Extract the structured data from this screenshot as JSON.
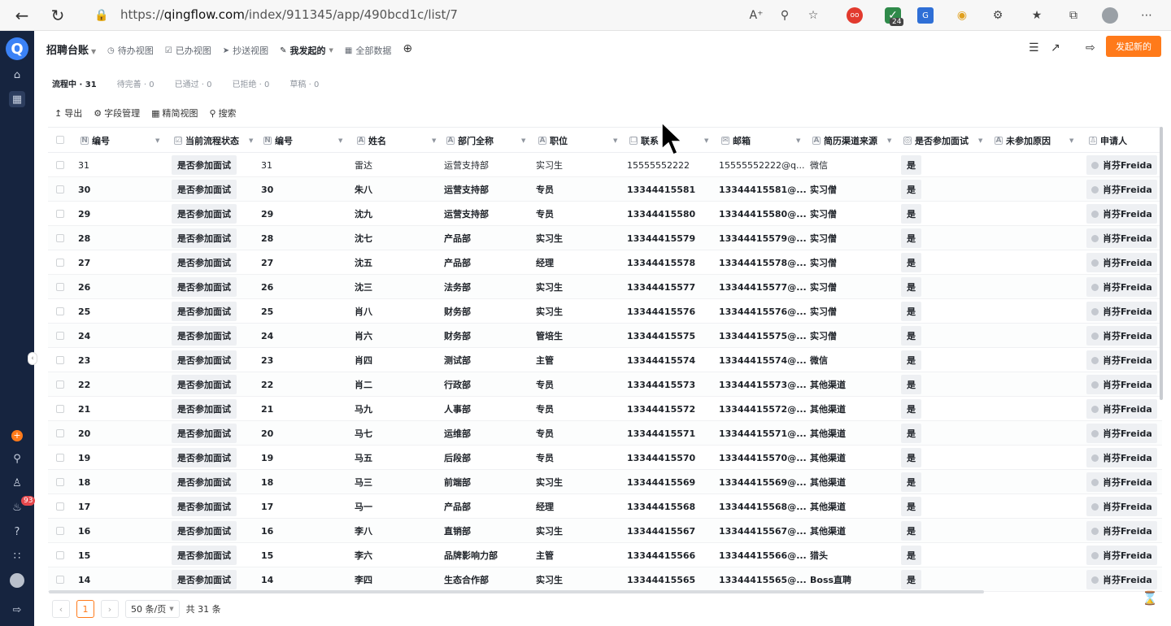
{
  "browser": {
    "url_prefix": "https://",
    "url_domain": "qingflow.com",
    "url_path": "/index/911345/app/490bcd1c/list/7",
    "ext_badge": "24"
  },
  "sidebar": {
    "logo": "Q",
    "notification_count": "93",
    "icons": [
      "home-icon",
      "apps-icon",
      "add-icon",
      "search-icon",
      "users-icon",
      "bell-icon",
      "help-icon",
      "grid-icon",
      "avatar",
      "expand-icon"
    ]
  },
  "header": {
    "app_title": "招聘台账",
    "views": [
      {
        "label": "待办视图",
        "icon": "clock-icon"
      },
      {
        "label": "已办视图",
        "icon": "check-square-icon"
      },
      {
        "label": "抄送视图",
        "icon": "send-icon"
      },
      {
        "label": "我发起的",
        "icon": "edit-square-icon"
      },
      {
        "label": "全部数据",
        "icon": "table-icon"
      }
    ],
    "launch_button": "发起新的"
  },
  "status_tabs": [
    "流程中 · 31",
    "待完善 · 0",
    "已通过 · 0",
    "已拒绝 · 0",
    "草稿 · 0"
  ],
  "toolbar": {
    "export": "导出",
    "fields": "字段管理",
    "compact": "精简视图",
    "search": "搜索"
  },
  "table": {
    "columns": [
      "编号",
      "当前流程状态",
      "编号",
      "姓名",
      "部门全称",
      "职位",
      "联系",
      "邮箱",
      "简历渠道来源",
      "是否参加面试",
      "未参加原因",
      "申请人"
    ],
    "rows": [
      [
        "31",
        "是否参加面试",
        "31",
        "雷达",
        "运营支持部",
        "实习生",
        "15555552222",
        "15555552222@q...",
        "微信",
        "是",
        "",
        "肖芬Freida"
      ],
      [
        "30",
        "是否参加面试",
        "30",
        "朱八",
        "运营支持部",
        "专员",
        "13344415581",
        "13344415581@...",
        "实习僧",
        "是",
        "",
        "肖芬Freida"
      ],
      [
        "29",
        "是否参加面试",
        "29",
        "沈九",
        "运营支持部",
        "专员",
        "13344415580",
        "13344415580@...",
        "实习僧",
        "是",
        "",
        "肖芬Freida"
      ],
      [
        "28",
        "是否参加面试",
        "28",
        "沈七",
        "产品部",
        "实习生",
        "13344415579",
        "13344415579@...",
        "实习僧",
        "是",
        "",
        "肖芬Freida"
      ],
      [
        "27",
        "是否参加面试",
        "27",
        "沈五",
        "产品部",
        "经理",
        "13344415578",
        "13344415578@...",
        "实习僧",
        "是",
        "",
        "肖芬Freida"
      ],
      [
        "26",
        "是否参加面试",
        "26",
        "沈三",
        "法务部",
        "实习生",
        "13344415577",
        "13344415577@...",
        "实习僧",
        "是",
        "",
        "肖芬Freida"
      ],
      [
        "25",
        "是否参加面试",
        "25",
        "肖八",
        "财务部",
        "实习生",
        "13344415576",
        "13344415576@...",
        "实习僧",
        "是",
        "",
        "肖芬Freida"
      ],
      [
        "24",
        "是否参加面试",
        "24",
        "肖六",
        "财务部",
        "管培生",
        "13344415575",
        "13344415575@...",
        "实习僧",
        "是",
        "",
        "肖芬Freida"
      ],
      [
        "23",
        "是否参加面试",
        "23",
        "肖四",
        "测试部",
        "主管",
        "13344415574",
        "13344415574@...",
        "微信",
        "是",
        "",
        "肖芬Freida"
      ],
      [
        "22",
        "是否参加面试",
        "22",
        "肖二",
        "行政部",
        "专员",
        "13344415573",
        "13344415573@...",
        "其他渠道",
        "是",
        "",
        "肖芬Freida"
      ],
      [
        "21",
        "是否参加面试",
        "21",
        "马九",
        "人事部",
        "专员",
        "13344415572",
        "13344415572@...",
        "其他渠道",
        "是",
        "",
        "肖芬Freida"
      ],
      [
        "20",
        "是否参加面试",
        "20",
        "马七",
        "运维部",
        "专员",
        "13344415571",
        "13344415571@...",
        "其他渠道",
        "是",
        "",
        "肖芬Freida"
      ],
      [
        "19",
        "是否参加面试",
        "19",
        "马五",
        "后段部",
        "专员",
        "13344415570",
        "13344415570@...",
        "其他渠道",
        "是",
        "",
        "肖芬Freida"
      ],
      [
        "18",
        "是否参加面试",
        "18",
        "马三",
        "前端部",
        "实习生",
        "13344415569",
        "13344415569@...",
        "其他渠道",
        "是",
        "",
        "肖芬Freida"
      ],
      [
        "17",
        "是否参加面试",
        "17",
        "马一",
        "产品部",
        "经理",
        "13344415568",
        "13344415568@...",
        "其他渠道",
        "是",
        "",
        "肖芬Freida"
      ],
      [
        "16",
        "是否参加面试",
        "16",
        "李八",
        "直销部",
        "实习生",
        "13344415567",
        "13344415567@...",
        "其他渠道",
        "是",
        "",
        "肖芬Freida"
      ],
      [
        "15",
        "是否参加面试",
        "15",
        "李六",
        "品牌影响力部",
        "主管",
        "13344415566",
        "13344415566@...",
        "猎头",
        "是",
        "",
        "肖芬Freida"
      ],
      [
        "14",
        "是否参加面试",
        "14",
        "李四",
        "生态合作部",
        "实习生",
        "13344415565",
        "13344415565@...",
        "Boss直聘",
        "是",
        "",
        "肖芬Freida"
      ]
    ]
  },
  "pagination": {
    "current_page": "1",
    "page_size": "50 条/页",
    "total": "共 31 条"
  },
  "colors": {
    "accent": "#ff7a1a",
    "sidebar_bg": "#16243f",
    "badge": "#e5484d"
  }
}
